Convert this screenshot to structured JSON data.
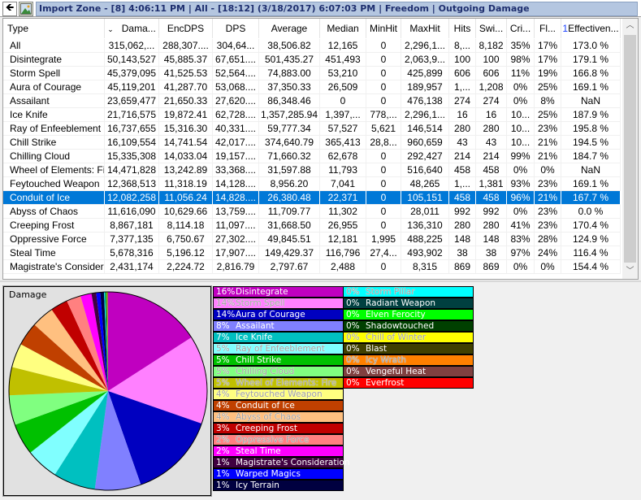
{
  "titlebar": {
    "back_icon": "back-arrow-icon",
    "image_icon": "picture-icon",
    "title": "Import Zone - [8] 4:06:11 PM | All - [18:12] (3/18/2017) 6:07:03 PM | Freedom  | Outgoing Damage"
  },
  "table": {
    "columns": [
      {
        "label": "Type"
      },
      {
        "label": "Dama...",
        "sort_indicator": "⌄"
      },
      {
        "label": "EncDPS"
      },
      {
        "label": "DPS"
      },
      {
        "label": "Average"
      },
      {
        "label": "Median"
      },
      {
        "label": "MinHit"
      },
      {
        "label": "MaxHit"
      },
      {
        "label": "Hits"
      },
      {
        "label": "Swi..."
      },
      {
        "label": "Cri..."
      },
      {
        "label": "Fl..."
      },
      {
        "label": "Effectiven...",
        "prefix": "1"
      }
    ],
    "selected_row": 11,
    "rows": [
      [
        "All",
        "315,062,...",
        "288,307....",
        "304,64...",
        "38,506.82",
        "12,165",
        "0",
        "2,296,1...",
        "8,...",
        "8,182",
        "35%",
        "17%",
        "173.0 %"
      ],
      [
        "Disintegrate",
        "50,143,527",
        "45,885.37",
        "67,651....",
        "501,435.27",
        "451,493",
        "0",
        "2,063,9...",
        "100",
        "100",
        "98%",
        "17%",
        "179.1 %"
      ],
      [
        "Storm Spell",
        "45,379,095",
        "41,525.53",
        "52,564....",
        "74,883.00",
        "53,210",
        "0",
        "425,899",
        "606",
        "606",
        "11%",
        "19%",
        "166.8 %"
      ],
      [
        "Aura of Courage",
        "45,119,201",
        "41,287.70",
        "53,068....",
        "37,350.33",
        "26,509",
        "0",
        "189,957",
        "1,...",
        "1,208",
        "0%",
        "25%",
        "169.1 %"
      ],
      [
        "Assailant",
        "23,659,477",
        "21,650.33",
        "27,620....",
        "86,348.46",
        "0",
        "0",
        "476,138",
        "274",
        "274",
        "0%",
        "8%",
        "NaN"
      ],
      [
        "Ice Knife",
        "21,716,575",
        "19,872.41",
        "62,728....",
        "1,357,285.94",
        "1,397,...",
        "778,...",
        "2,296,1...",
        "16",
        "16",
        "10...",
        "25%",
        "187.9 %"
      ],
      [
        "Ray of Enfeeblement",
        "16,737,655",
        "15,316.30",
        "40,331....",
        "59,777.34",
        "57,527",
        "5,621",
        "146,514",
        "280",
        "280",
        "10...",
        "23%",
        "195.8 %"
      ],
      [
        "Chill Strike",
        "16,109,554",
        "14,741.54",
        "42,017....",
        "374,640.79",
        "365,413",
        "28,8...",
        "960,659",
        "43",
        "43",
        "10...",
        "21%",
        "194.5 %"
      ],
      [
        "Chilling Cloud",
        "15,335,308",
        "14,033.04",
        "19,157....",
        "71,660.32",
        "62,678",
        "0",
        "292,427",
        "214",
        "214",
        "99%",
        "21%",
        "184.7 %"
      ],
      [
        "Wheel of Elements: Fire",
        "14,471,828",
        "13,242.89",
        "33,368....",
        "31,597.88",
        "11,793",
        "0",
        "516,640",
        "458",
        "458",
        "0%",
        "0%",
        "NaN"
      ],
      [
        "Feytouched Weapon",
        "12,368,513",
        "11,318.19",
        "14,128....",
        "8,956.20",
        "7,041",
        "0",
        "48,265",
        "1,...",
        "1,381",
        "93%",
        "23%",
        "169.1 %"
      ],
      [
        "Conduit of Ice",
        "12,082,258",
        "11,056.24",
        "14,828....",
        "26,380.48",
        "22,371",
        "0",
        "105,151",
        "458",
        "458",
        "96%",
        "21%",
        "167.7 %"
      ],
      [
        "Abyss of Chaos",
        "11,616,090",
        "10,629.66",
        "13,759....",
        "11,709.77",
        "11,302",
        "0",
        "28,011",
        "992",
        "992",
        "0%",
        "23%",
        "0.0 %"
      ],
      [
        "Creeping Frost",
        "8,867,181",
        "8,114.18",
        "11,097....",
        "31,668.50",
        "26,955",
        "0",
        "136,310",
        "280",
        "280",
        "41%",
        "23%",
        "170.4 %"
      ],
      [
        "Oppressive Force",
        "7,377,135",
        "6,750.67",
        "27,302....",
        "49,845.51",
        "12,181",
        "1,995",
        "488,225",
        "148",
        "148",
        "83%",
        "28%",
        "124.9 %"
      ],
      [
        "Steal Time",
        "5,678,316",
        "5,196.12",
        "17,907....",
        "149,429.37",
        "116,796",
        "27,4...",
        "493,902",
        "38",
        "38",
        "97%",
        "24%",
        "116.4 %"
      ],
      [
        "Magistrate's Consider...",
        "2,431,174",
        "2,224.72",
        "2,816.79",
        "2,797.67",
        "2,488",
        "0",
        "8,315",
        "869",
        "869",
        "0%",
        "0%",
        "154.4 %"
      ]
    ],
    "scroll_up_icon": "chevron-up-icon",
    "scroll_down_icon": "chevron-down-icon"
  },
  "chart_data": {
    "type": "pie",
    "title": "Damage",
    "legend_placement": "right",
    "slices": [
      {
        "label": "Disintegrate",
        "pct_label": "16%",
        "value": 50143527,
        "color": "#c000c0"
      },
      {
        "label": "Storm Spell",
        "pct_label": "14%",
        "value": 45379095,
        "color": "#ff80ff"
      },
      {
        "label": "Aura of Courage",
        "pct_label": "14%",
        "value": 45119201,
        "color": "#0000c0"
      },
      {
        "label": "Assailant",
        "pct_label": "8%",
        "value": 23659477,
        "color": "#8080ff"
      },
      {
        "label": "Ice Knife",
        "pct_label": "7%",
        "value": 21716575,
        "color": "#00c0c0"
      },
      {
        "label": "Ray of Enfeeblement",
        "pct_label": "5%",
        "value": 16737655,
        "color": "#80ffff"
      },
      {
        "label": "Chill Strike",
        "pct_label": "5%",
        "value": 16109554,
        "color": "#00c000"
      },
      {
        "label": "Chilling Cloud",
        "pct_label": "5%",
        "value": 15335308,
        "color": "#80ff80"
      },
      {
        "label": "Wheel of Elements: Fire",
        "pct_label": "5%",
        "value": 14471828,
        "color": "#c0c000"
      },
      {
        "label": "Feytouched Weapon",
        "pct_label": "4%",
        "value": 12368513,
        "color": "#ffff80"
      },
      {
        "label": "Conduit of Ice",
        "pct_label": "4%",
        "value": 12082258,
        "color": "#c04000"
      },
      {
        "label": "Abyss of Chaos",
        "pct_label": "4%",
        "value": 11616090,
        "color": "#ffc080"
      },
      {
        "label": "Creeping Frost",
        "pct_label": "3%",
        "value": 8867181,
        "color": "#c00000"
      },
      {
        "label": "Oppressive Force",
        "pct_label": "2%",
        "value": 7377135,
        "color": "#ff8080"
      },
      {
        "label": "Steal Time",
        "pct_label": "2%",
        "value": 5678316,
        "color": "#ff00ff"
      },
      {
        "label": "Magistrate's Consideration",
        "pct_label": "1%",
        "value": 2431174,
        "color": "#400040"
      },
      {
        "label": "Warped Magics",
        "pct_label": "1%",
        "value": 2100000,
        "color": "#0000ff"
      },
      {
        "label": "Icy Terrain",
        "pct_label": "1%",
        "value": 1900000,
        "color": "#000040"
      },
      {
        "label": "Storm Pillar",
        "pct_label": "0%",
        "value": 500000,
        "color": "#00ffff"
      },
      {
        "label": "Radiant Weapon",
        "pct_label": "0%",
        "value": 400000,
        "color": "#004040"
      },
      {
        "label": "Elven Ferocity",
        "pct_label": "0%",
        "value": 300000,
        "color": "#00ff00"
      },
      {
        "label": "Shadowtouched",
        "pct_label": "0%",
        "value": 250000,
        "color": "#004000"
      },
      {
        "label": "Chill of Winter",
        "pct_label": "0%",
        "value": 200000,
        "color": "#ffff00"
      },
      {
        "label": "Blast",
        "pct_label": "0%",
        "value": 150000,
        "color": "#404000"
      },
      {
        "label": "Icy Wrath",
        "pct_label": "0%",
        "value": 100000,
        "color": "#ff8000"
      },
      {
        "label": "Vengeful Heat",
        "pct_label": "0%",
        "value": 80000,
        "color": "#804040"
      },
      {
        "label": "Everfrost",
        "pct_label": "0%",
        "value": 60000,
        "color": "#ff0000"
      }
    ]
  }
}
